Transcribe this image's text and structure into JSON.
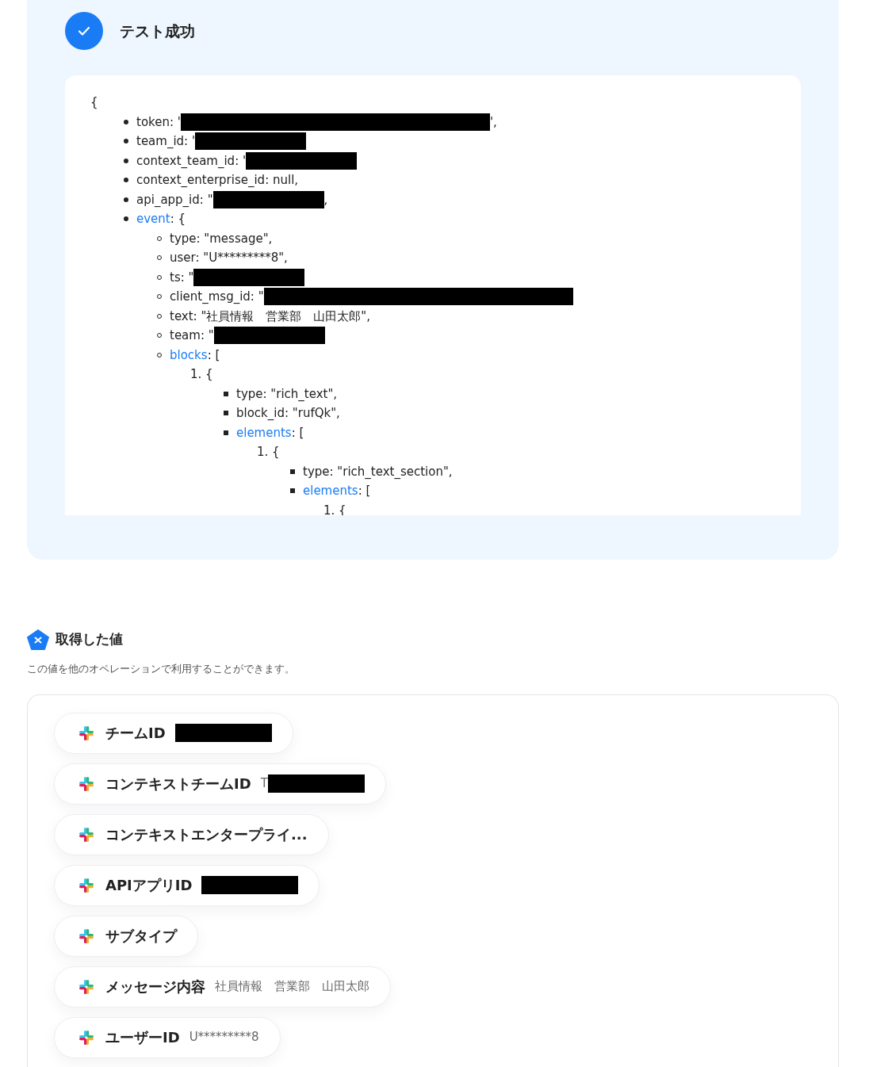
{
  "test_result": {
    "checked": true,
    "title": "テスト成功",
    "code": [
      {
        "text": "{",
        "children": [
          {
            "kind": "disc",
            "key": "token",
            "text": ": '",
            "redacted": true,
            "long": true,
            "tail": "',"
          },
          {
            "kind": "disc",
            "key": "team_id",
            "text": ": '",
            "redacted": true
          },
          {
            "kind": "disc",
            "key": "context_team_id",
            "text": ": '",
            "redacted": true
          },
          {
            "kind": "disc",
            "key": "context_enterprise_id",
            "text": ": null,"
          },
          {
            "kind": "disc",
            "key": "api_app_id",
            "text": ": \"",
            "redacted": true,
            "tail": ","
          },
          {
            "kind": "disc",
            "key": "event",
            "link": true,
            "text": ": {",
            "children": [
              {
                "kind": "circle",
                "key": "type",
                "text": ": \"message\","
              },
              {
                "kind": "circle",
                "key": "user",
                "text": ": \"U*********8\","
              },
              {
                "kind": "circle",
                "key": "ts",
                "text": ": \"",
                "redacted": true
              },
              {
                "kind": "circle",
                "key": "client_msg_id",
                "text": ": \"",
                "redacted": true,
                "long": true
              },
              {
                "kind": "circle",
                "key": "text",
                "text": ": \"社員情報　営業部　山田太郎\","
              },
              {
                "kind": "circle",
                "key": "team",
                "text": ": \"",
                "redacted": true
              },
              {
                "kind": "circle",
                "key": "blocks",
                "link": true,
                "text": ": [",
                "children": [
                  {
                    "text": "1. {",
                    "children": [
                      {
                        "kind": "square",
                        "key": "type",
                        "text": ": \"rich_text\","
                      },
                      {
                        "kind": "square",
                        "key": "block_id",
                        "text": ": \"rufQk\","
                      },
                      {
                        "kind": "square",
                        "key": "elements",
                        "link": true,
                        "text": ": [",
                        "children": [
                          {
                            "text": "1. {",
                            "children": [
                              {
                                "kind": "square",
                                "key": "type",
                                "text": ": \"rich_text_section\","
                              },
                              {
                                "kind": "square",
                                "key": "elements",
                                "link": true,
                                "text": ": [",
                                "children": [
                                  {
                                    "text": "1. {"
                                  }
                                ]
                              }
                            ]
                          }
                        ]
                      }
                    ]
                  }
                ]
              }
            ]
          }
        ]
      }
    ]
  },
  "values": {
    "title": "取得した値",
    "description": "この値を他のオペレーションで利用することができます。",
    "items": [
      {
        "label": "チームID",
        "redacted": true
      },
      {
        "label": "コンテキストチームID",
        "value": "T",
        "redacted": true
      },
      {
        "label": "コンテキストエンタープライ..."
      },
      {
        "label": "APIアプリID",
        "redacted": true
      },
      {
        "label": "サブタイプ"
      },
      {
        "label": "メッセージ内容",
        "value": "社員情報　営業部　山田太郎"
      },
      {
        "label": "ユーザーID",
        "value": "U*********8"
      }
    ]
  }
}
